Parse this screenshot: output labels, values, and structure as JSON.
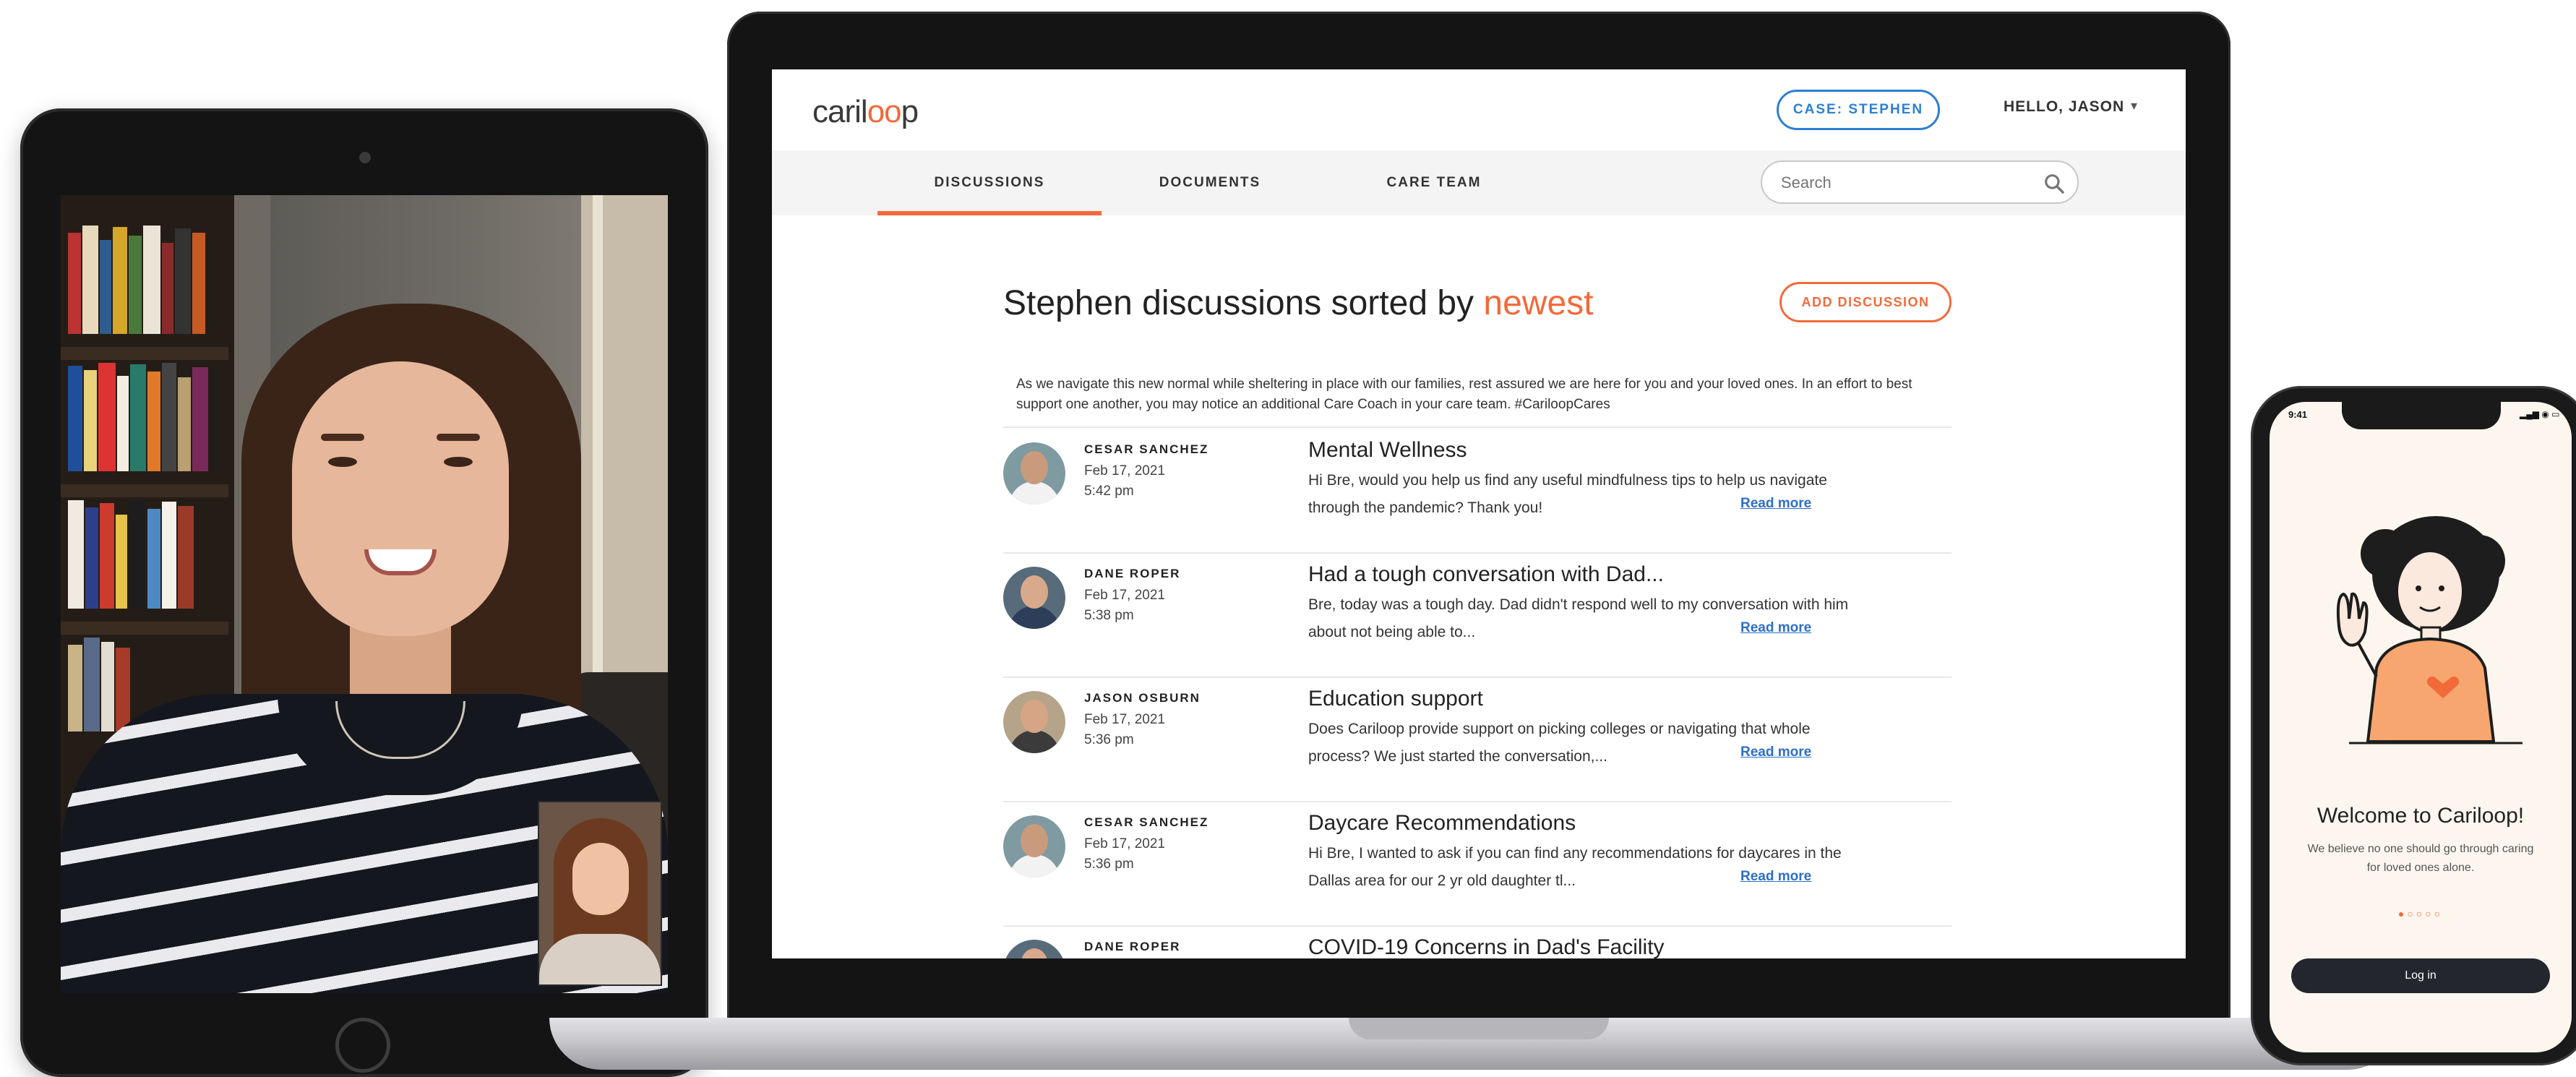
{
  "app": {
    "logo_text_pre": "caril",
    "logo_text_o": "oo",
    "logo_text_post": "p",
    "accent_color": "#f26a3a",
    "link_color": "#2d6fc7"
  },
  "header": {
    "case_label": "CASE: STEPHEN",
    "greeting": "HELLO, JASON",
    "greeting_caret": "▾"
  },
  "nav": {
    "tabs": [
      {
        "label": "DISCUSSIONS",
        "active": true
      },
      {
        "label": "DOCUMENTS",
        "active": false
      },
      {
        "label": "CARE TEAM",
        "active": false
      }
    ],
    "search_placeholder": "Search"
  },
  "main": {
    "title_prefix": "Stephen discussions sorted by ",
    "title_sort": "newest",
    "add_button": "ADD DISCUSSION",
    "notice": "As we navigate this new normal while sheltering in place with our families, rest assured we are here for you and your loved ones. In an effort to best support one another, you may notice an additional Care Coach in your care team. #CariloopCares",
    "read_more": "Read more",
    "discussions": [
      {
        "author": "CESAR SANCHEZ",
        "date": "Feb 17, 2021",
        "time": "5:42 pm",
        "title": "Mental Wellness",
        "body": "Hi Bre, would you help us find any useful mindfulness tips to help us navigate through the pandemic? Thank you!",
        "avatar_bg": "#7f9aa1",
        "avatar_skin": "#c99b7c",
        "avatar_shirt": "#f2f2f2"
      },
      {
        "author": "DANE ROPER",
        "date": "Feb 17, 2021",
        "time": "5:38 pm",
        "title": "Had a tough conversation with Dad...",
        "body": "Bre, today was a tough day. Dad didn't respond well to my conversation with him about not being able to...",
        "avatar_bg": "#586b7a",
        "avatar_skin": "#d9a98c",
        "avatar_shirt": "#2d3e5a"
      },
      {
        "author": "JASON OSBURN",
        "date": "Feb 17, 2021",
        "time": "5:36 pm",
        "title": "Education support",
        "body": "Does Cariloop provide support on picking colleges or navigating that whole process? We just started the conversation,...",
        "avatar_bg": "#b5a48a",
        "avatar_skin": "#d6a585",
        "avatar_shirt": "#3b3b3b"
      },
      {
        "author": "CESAR SANCHEZ",
        "date": "Feb 17, 2021",
        "time": "5:36 pm",
        "title": "Daycare Recommendations",
        "body": "Hi Bre, I wanted to ask if you can find any recommendations for daycares in the Dallas area for our 2 yr old daughter tl...",
        "avatar_bg": "#7f9aa1",
        "avatar_skin": "#c99b7c",
        "avatar_shirt": "#f2f2f2"
      },
      {
        "author": "DANE ROPER",
        "date": "",
        "time": "",
        "title": "COVID-19 Concerns in Dad's Facility",
        "body": "",
        "avatar_bg": "#586b7a",
        "avatar_skin": "#d9a98c",
        "avatar_shirt": "#2d3e5a"
      }
    ]
  },
  "phone": {
    "time": "9:41",
    "status": "▂▄▆ ◉ ▭",
    "welcome": "Welcome to Cariloop!",
    "tagline": "We believe no one should go through caring for loved ones alone.",
    "dots": "●○○○○",
    "login": "Log in"
  }
}
